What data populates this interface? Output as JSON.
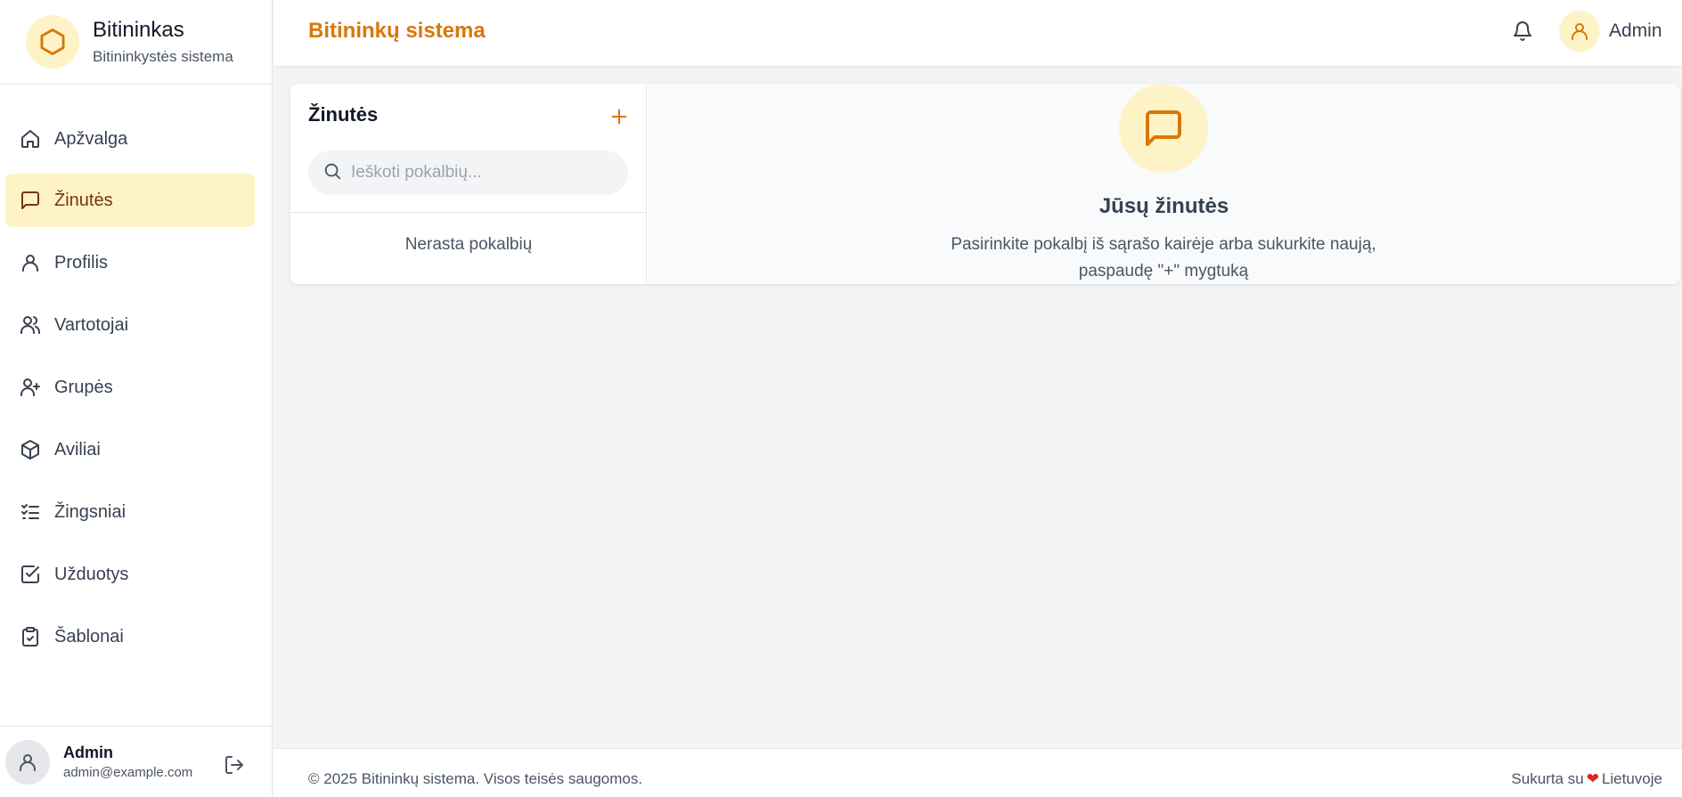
{
  "brand": {
    "name": "Bitininkas",
    "subtitle": "Bitininkystės sistema"
  },
  "sidebar": {
    "items": [
      {
        "label": "Apžvalga",
        "icon": "home-icon"
      },
      {
        "label": "Žinutės",
        "icon": "message-icon",
        "active": true
      },
      {
        "label": "Profilis",
        "icon": "user-icon"
      },
      {
        "label": "Vartotojai",
        "icon": "users-icon"
      },
      {
        "label": "Grupės",
        "icon": "user-plus-icon"
      },
      {
        "label": "Aviliai",
        "icon": "box-icon"
      },
      {
        "label": "Žingsniai",
        "icon": "list-checks-icon"
      },
      {
        "label": "Užduotys",
        "icon": "check-square-icon"
      },
      {
        "label": "Šablonai",
        "icon": "clipboard-check-icon"
      }
    ]
  },
  "user": {
    "name": "Admin",
    "email": "admin@example.com"
  },
  "header": {
    "title": "Bitininkų sistema",
    "user_name": "Admin"
  },
  "messages": {
    "title": "Žinutės",
    "search_placeholder": "Ieškoti pokalbių...",
    "empty_text": "Nerasta pokalbių",
    "placeholder_title": "Jūsų žinutės",
    "placeholder_text": "Pasirinkite pokalbį iš sąrašo kairėje arba sukurkite naują, paspaudę \"+\" mygtuką"
  },
  "footer": {
    "copyright": "© 2025 Bitininkų sistema. Visos teisės saugomos.",
    "made_prefix": "Sukurta su",
    "made_suffix": "Lietuvoje"
  },
  "colors": {
    "accent": "#d97706",
    "accent_light": "#fef3c7",
    "active_text": "#78350f"
  }
}
